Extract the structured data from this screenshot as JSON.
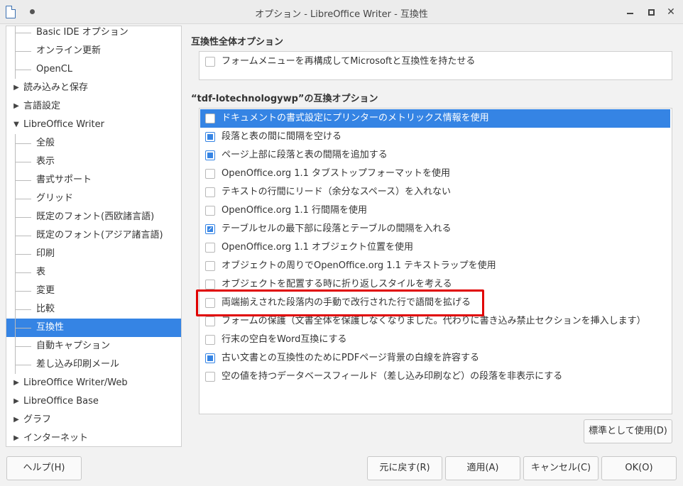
{
  "window": {
    "title": "オプション - LibreOffice Writer - 互換性",
    "close_glyph": "✕"
  },
  "tree": {
    "items": [
      {
        "label": "Basic IDE オプション",
        "level": "child"
      },
      {
        "label": "オンライン更新",
        "level": "child"
      },
      {
        "label": "OpenCL",
        "level": "child"
      },
      {
        "label": "読み込みと保存",
        "level": "parent",
        "arrow": "▶"
      },
      {
        "label": "言語設定",
        "level": "parent",
        "arrow": "▶"
      },
      {
        "label": "LibreOffice Writer",
        "level": "parent",
        "arrow": "▼"
      },
      {
        "label": "全般",
        "level": "child"
      },
      {
        "label": "表示",
        "level": "child"
      },
      {
        "label": "書式サポート",
        "level": "child"
      },
      {
        "label": "グリッド",
        "level": "child"
      },
      {
        "label": "既定のフォント(西欧諸言語)",
        "level": "child"
      },
      {
        "label": "既定のフォント(アジア諸言語)",
        "level": "child"
      },
      {
        "label": "印刷",
        "level": "child"
      },
      {
        "label": "表",
        "level": "child"
      },
      {
        "label": "変更",
        "level": "child"
      },
      {
        "label": "比較",
        "level": "child"
      },
      {
        "label": "互換性",
        "level": "child",
        "selected": true
      },
      {
        "label": "自動キャプション",
        "level": "child"
      },
      {
        "label": "差し込み印刷メール",
        "level": "child"
      },
      {
        "label": "LibreOffice Writer/Web",
        "level": "parent",
        "arrow": "▶"
      },
      {
        "label": "LibreOffice Base",
        "level": "parent",
        "arrow": "▶"
      },
      {
        "label": "グラフ",
        "level": "parent",
        "arrow": "▶"
      },
      {
        "label": "インターネット",
        "level": "parent",
        "arrow": "▶"
      }
    ]
  },
  "global_section": {
    "title": "互換性全体オプション",
    "option": {
      "label": "フォームメニューを再構成してMicrosoftと互換性を持たせる",
      "checked": false
    }
  },
  "doc_section": {
    "title": "“tdf-lotechnologywp”の互換オプション",
    "options": [
      {
        "label": "ドキュメントの書式設定にプリンターのメトリックス情報を使用",
        "checked": false,
        "selected": true
      },
      {
        "label": "段落と表の間に間隔を空ける",
        "checked": true
      },
      {
        "label": "ページ上部に段落と表の間隔を追加する",
        "checked": true
      },
      {
        "label": "OpenOffice.org 1.1 タブストップフォーマットを使用",
        "checked": false
      },
      {
        "label": "テキストの行間にリード（余分なスペース）を入れない",
        "checked": false
      },
      {
        "label": "OpenOffice.org 1.1 行間隔を使用",
        "checked": false
      },
      {
        "label": "テーブルセルの最下部に段落とテーブルの間隔を入れる",
        "checked": true,
        "partial": true
      },
      {
        "label": "OpenOffice.org 1.1 オブジェクト位置を使用",
        "checked": false
      },
      {
        "label": "オブジェクトの周りでOpenOffice.org 1.1 テキストラップを使用",
        "checked": false
      },
      {
        "label": "オブジェクトを配置する時に折り返しスタイルを考える",
        "checked": false
      },
      {
        "label": "両端揃えされた段落内の手動で改行された行で語間を拡げる",
        "checked": false
      },
      {
        "label": "フォームの保護（文書全体を保護しなくなりました。代わりに書き込み禁止セクションを挿入します）",
        "checked": false
      },
      {
        "label": "行末の空白をWord互換にする",
        "checked": false
      },
      {
        "label": "古い文書との互換性のためにPDFページ背景の白線を許容する",
        "checked": true
      },
      {
        "label": "空の値を持つデータベースフィールド（差し込み印刷など）の段落を非表示にする",
        "checked": false
      }
    ]
  },
  "buttons": {
    "use_as_default": "標準として使用(D)",
    "help": "ヘルプ(H)",
    "reset": "元に戻す(R)",
    "apply": "適用(A)",
    "cancel": "キャンセル(C)",
    "ok": "OK(O)"
  },
  "colors": {
    "accent": "#3584e4",
    "highlight": "#e00000"
  }
}
